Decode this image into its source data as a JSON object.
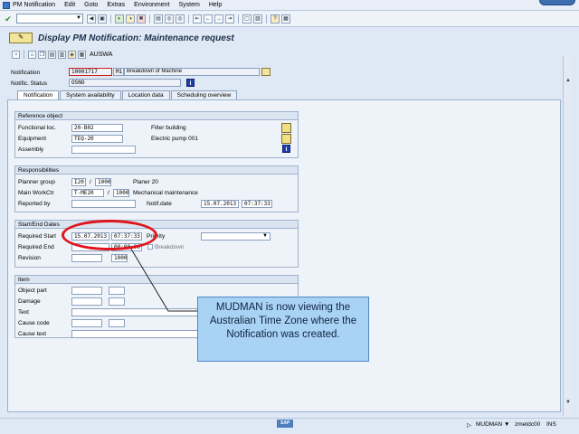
{
  "menu": [
    "PM Notification",
    "Edit",
    "Goto",
    "Extras",
    "Environment",
    "System",
    "Help"
  ],
  "title": "Display PM Notification: Maintenance request",
  "app_toolbar": {
    "auswa_label": "AUSWA"
  },
  "header": {
    "notification_label": "Notification",
    "notification_value": "10001717",
    "notif_type": "M1",
    "notif_desc": "Breakdown of Machine",
    "status_label": "Notific. Status",
    "status_value": "OSNO"
  },
  "tabs": [
    "Notification",
    "System availability",
    "Location data",
    "Scheduling overview"
  ],
  "reference_object": {
    "title": "Reference object",
    "functional_loc_label": "Functional loc.",
    "functional_loc_value": "20-B02",
    "functional_loc_desc": "Filter building",
    "equipment_label": "Equipment",
    "equipment_value": "TEQ-20",
    "equipment_desc": "Electric pump 001",
    "assembly_label": "Assembly"
  },
  "responsibilities": {
    "title": "Responsibilities",
    "planner_group_label": "Planner group",
    "planner_group_value": "I20",
    "planner_plant": "1000",
    "planner_desc": "Planer 20",
    "main_workctr_label": "Main WorkCtr",
    "main_workctr_value": "T-ME20",
    "workctr_plant": "1000",
    "workctr_desc": "Mechanical maintenance",
    "reported_by_label": "Reported by",
    "notif_date_label": "Notif.date",
    "notif_date": "15.07.2013",
    "notif_time": "07:37:33"
  },
  "dates": {
    "title": "Start/End Dates",
    "req_start_label": "Required Start",
    "req_start_date": "15.07.2013",
    "req_start_time": "07:37:33",
    "priority_label": "Priority",
    "req_end_label": "Required End",
    "req_end_time": "00:00:00",
    "breakdown_label": "Breakdown",
    "revision_label": "Revision",
    "revision_plant": "1000"
  },
  "item": {
    "title": "Item",
    "object_part_label": "Object part",
    "damage_label": "Damage",
    "text_label": "Text",
    "cause_code_label": "Cause code",
    "cause_text_label": "Cause text"
  },
  "callout": "MUDMAN is now viewing the Australian Time Zone where the Notification was created.",
  "status_bar": {
    "sap_logo": "SAP",
    "user": "MUDMAN",
    "server": "zmetdc00",
    "mode": "INS"
  }
}
